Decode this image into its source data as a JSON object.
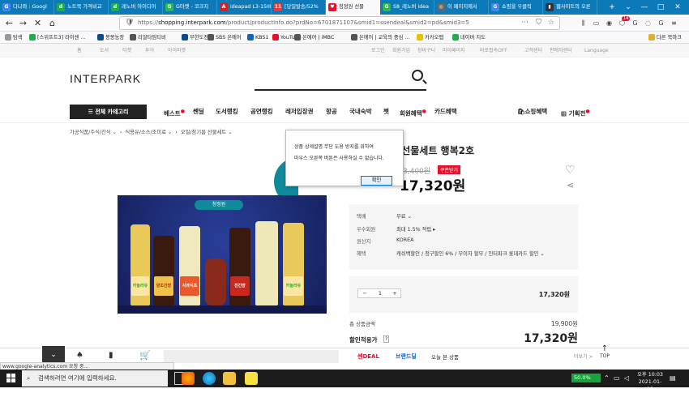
{
  "tabs": [
    {
      "label": "다나와 : Googl",
      "fav": "G",
      "color": "#4285f4"
    },
    {
      "label": "노트북 가격비교",
      "fav": "d",
      "color": "#1fae4b"
    },
    {
      "label": "레노버 아이디어",
      "fav": "d",
      "color": "#1fae4b"
    },
    {
      "label": "G마켓 - 코크지",
      "fav": "G",
      "color": "#2fb84a"
    },
    {
      "label": "ideapad L3-15IIL",
      "fav": "A",
      "color": "#d92020"
    },
    {
      "label": "[당일발송/52%",
      "fav": "11",
      "color": "#e83838"
    },
    {
      "label": "청정원 선물",
      "fav": "♥",
      "color": "#e8112d"
    },
    {
      "label": "S8_레노버 idea",
      "fav": "G",
      "color": "#2fb84a"
    },
    {
      "label": "이 페이지에서",
      "fav": "◎",
      "color": "#666"
    },
    {
      "label": "쇼핑을 우클릭",
      "fav": "G",
      "color": "#4285f4"
    },
    {
      "label": "웹사이트의 오른",
      "fav": "▮",
      "color": "#333"
    }
  ],
  "window": {
    "new_tab": "+",
    "dropdown": "⌄",
    "minimize": "—",
    "maximize": "□",
    "close": "✕"
  },
  "nav": {
    "back": "←",
    "forward": "→",
    "stop": "✕",
    "home": "⌂",
    "url_prefix": "https://",
    "url_domain": "shopping.interpark.com",
    "url_path": "/product/productInfo.do?prdNo=6701871107&smid1=ssendeal&smid2=pd&smid3=5",
    "more": "···",
    "pocket": "⛉",
    "star": "☆",
    "toolbar_icons": [
      "⫼",
      "▭",
      "◉",
      "⬡",
      "G",
      "◌",
      "G",
      "≡"
    ],
    "badge": "14"
  },
  "bookmarks": [
    {
      "label": "탐색",
      "color": "#999"
    },
    {
      "label": "[스위프트3] 라이센 ...",
      "color": "#1fae4b"
    },
    {
      "label": "몽몽농장",
      "color": "#0f4b8a"
    },
    {
      "label": "리얼타임티비",
      "color": "#555"
    },
    {
      "label": "무한도전",
      "color": "#0f4b8a"
    },
    {
      "label": "SBS 온에어",
      "color": "#555"
    },
    {
      "label": "KBS1",
      "color": "#1464c8"
    },
    {
      "label": "YouTube",
      "color": "#e8112d"
    },
    {
      "label": "온에어 | iMBC",
      "color": "#555"
    },
    {
      "label": "온에어 | 교육의 중심 ...",
      "color": "#555"
    },
    {
      "label": "카카오맵",
      "color": "#e6c200"
    },
    {
      "label": "네이버 지도",
      "color": "#1fae4b"
    }
  ],
  "other_bookmarks": "다른 북마크",
  "util_left": [
    "홈",
    "도서",
    "티켓",
    "투어",
    "아이마켓"
  ],
  "util_right": [
    "로그인",
    "회원가입",
    "장바구니",
    "마이페이지",
    "바로접속OFF",
    "고객센터",
    "판매자센터",
    "Language"
  ],
  "logo": "INTERPARK",
  "category_button": "전체 카테고리",
  "gnb": [
    "베스트",
    "쎈딜",
    "도서랭킹",
    "공연랭킹",
    "레저입장권",
    "항공",
    "국내숙박",
    "펫",
    "회원혜택",
    "카드혜택"
  ],
  "gnb_right": [
    "쇼핑혜택",
    "기획전"
  ],
  "breadcrumb": [
    "가공식품/주식/간식",
    "식용유/소스/조미료",
    "오일/참기름 선물세트"
  ],
  "product": {
    "title": "청정원 선물세트 행복2호",
    "title_visible": "원 선물세트 행복2호",
    "orig_price": "23,400원",
    "orig_price_visible": "3,400원",
    "coupon": "쿠폰받기",
    "sale_price": "17,320원",
    "sale_price_visible": "17,320원",
    "brand_label": "청정원",
    "bottle_labels": [
      "카놀라유",
      "양조간장",
      "사과식초",
      "진간장",
      "카놀라유"
    ]
  },
  "info": [
    {
      "label": "택배",
      "value": "무료 ⌄"
    },
    {
      "label": "우수회원",
      "value": "최대 1.5% 적립 ▸"
    },
    {
      "label": "원산지",
      "value": "KOREA"
    },
    {
      "label": "혜택",
      "value": "캐쉬백할인 / 청구할인 6% / 무이자 할부 / 인터파크 롯데카드 할인 ⌄"
    }
  ],
  "quantity": {
    "minus": "−",
    "value": "1",
    "plus": "+",
    "price": "17,320원"
  },
  "total": {
    "label": "총 상품금액",
    "value": "19,900원"
  },
  "apply": {
    "label": "할인적용가",
    "value": "17,320원"
  },
  "bottom_bar": {
    "deal": "쎈DEAL",
    "brand": "브랜드딜",
    "today": "오늘 본 상품",
    "more": "더보기 >",
    "top": "TOP"
  },
  "dialog": {
    "line1": "상품 상세설명 무단 도용 방지를 위하여",
    "line2": "마우스 오른쪽 버튼은 사용하실 수 없습니다.",
    "ok": "확인"
  },
  "status": "www.google-analytics.com 요청 중...",
  "taskbar": {
    "search_placeholder": "검색하려면 여기에 입력하세요.",
    "battery": "50.0%",
    "time": "오후 10:03",
    "date": "2021-01-19"
  }
}
